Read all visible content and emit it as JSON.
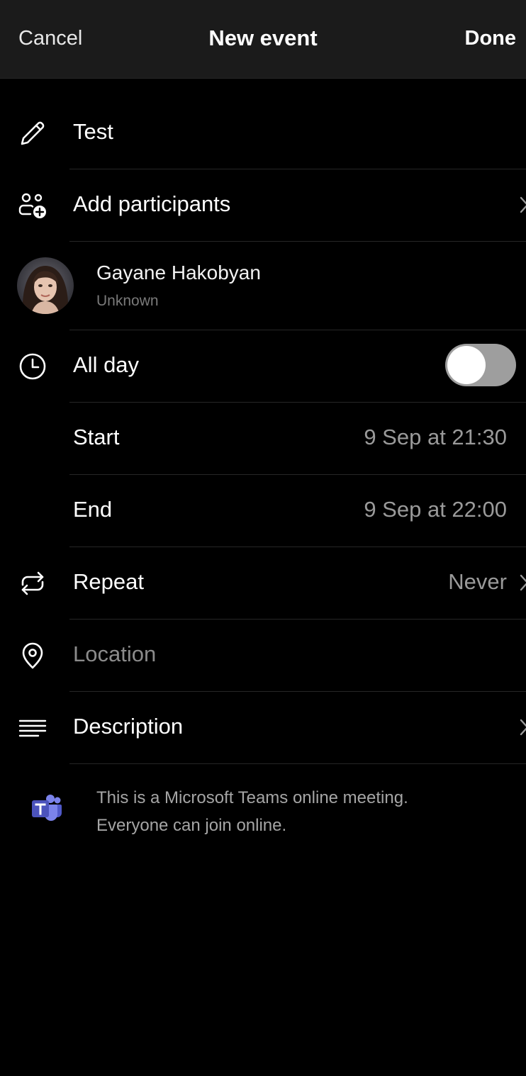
{
  "header": {
    "cancel_label": "Cancel",
    "title": "New event",
    "done_label": "Done"
  },
  "title_row": {
    "value": "Test",
    "icon": "pencil-icon"
  },
  "participants_row": {
    "label": "Add participants",
    "icon": "add-people-icon"
  },
  "participant": {
    "name": "Gayane Hakobyan",
    "status": "Unknown"
  },
  "all_day_row": {
    "label": "All day",
    "icon": "clock-icon",
    "enabled": false
  },
  "start_row": {
    "label": "Start",
    "value": "9 Sep at 21:30"
  },
  "end_row": {
    "label": "End",
    "value": "9 Sep at 22:00"
  },
  "repeat_row": {
    "label": "Repeat",
    "value": "Never",
    "icon": "repeat-icon"
  },
  "location_row": {
    "placeholder": "Location",
    "icon": "location-pin-icon"
  },
  "description_row": {
    "label": "Description",
    "icon": "text-lines-icon"
  },
  "teams_note": {
    "line1": "This is a Microsoft Teams online meeting.",
    "line2": "Everyone can join online.",
    "icon": "microsoft-teams-icon"
  },
  "colors": {
    "background": "#000000",
    "header_background": "#1b1b1b",
    "secondary_text": "#9a9a9a",
    "teams_brand": "#5059c9"
  }
}
